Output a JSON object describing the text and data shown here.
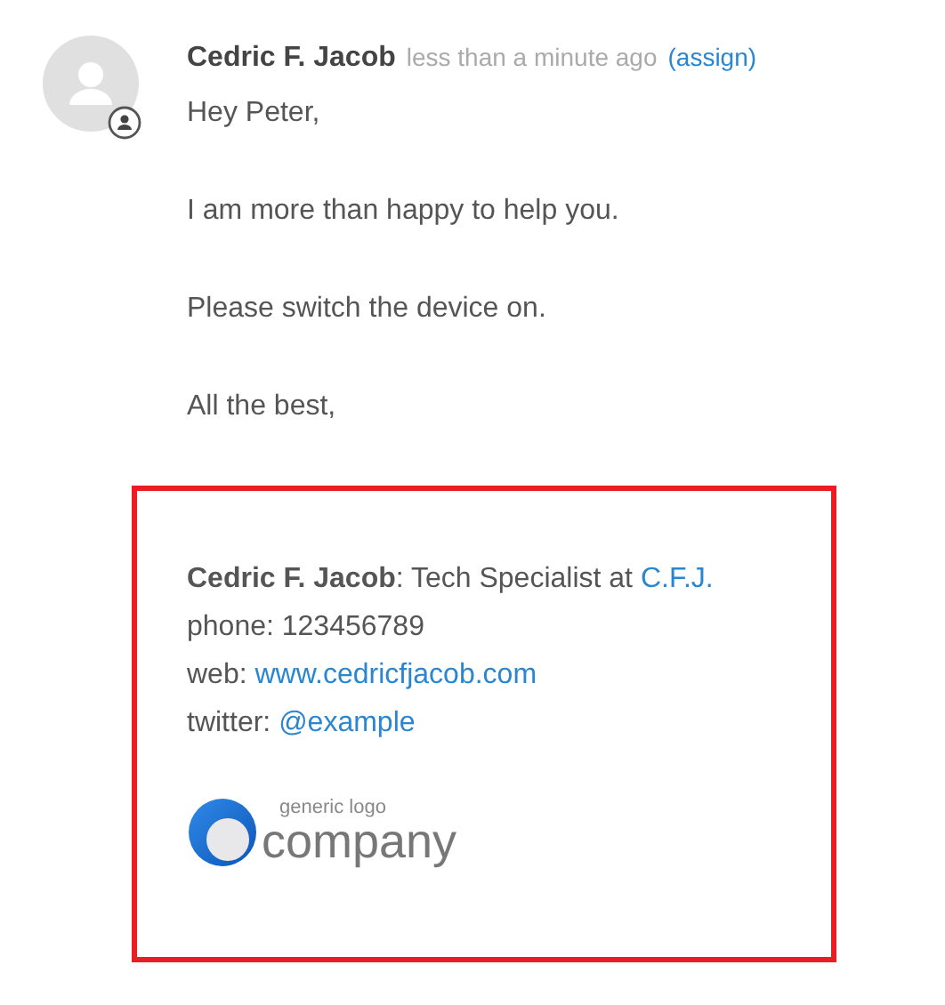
{
  "comment": {
    "author": "Cedric F. Jacob",
    "time": "less than a minute ago",
    "action": "(assign)",
    "paragraphs": [
      "Hey Peter,",
      "I am more than happy to help you.",
      "Please switch the device on.",
      "All the best,"
    ],
    "signature": {
      "lines": [
        {
          "text": "**Cedric F. Jacob**: Tech Specialist at ",
          "link": "C.F.J."
        },
        {
          "text": "phone: 123456789"
        },
        {
          "text": "web: ",
          "link": "www.cedricfjacob.com"
        },
        {
          "text": "twitter: ",
          "link": "@example"
        }
      ],
      "logo": {
        "tagline": "generic logo",
        "name": "company"
      }
    }
  }
}
